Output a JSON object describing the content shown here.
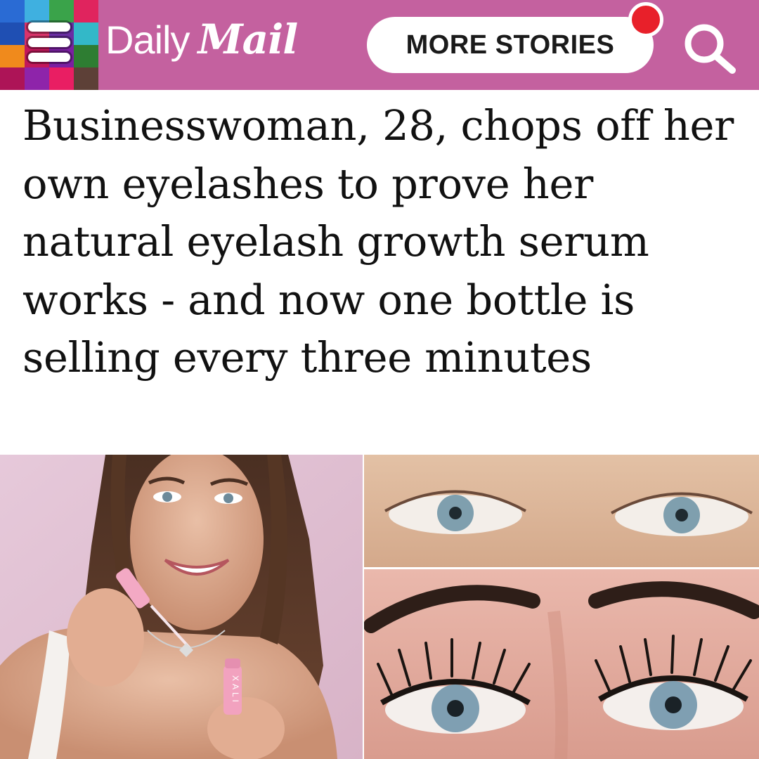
{
  "header": {
    "logo_daily": "Daily",
    "logo_mail": "Mail",
    "more_stories_label": "MORE STORIES",
    "icons": {
      "menu": "hamburger-menu-icon",
      "search": "search-icon",
      "notification": "notification-dot"
    },
    "colors": {
      "background": "#c4619f",
      "notification": "#e8202a",
      "menu_tiles": [
        "#2a6bd4",
        "#3fb0e0",
        "#3aa34a",
        "#e0245e",
        "#1f4fb3",
        "#d9336b",
        "#6a2ea3",
        "#33b8c8",
        "#f08a1c",
        "#c2185b",
        "#7b1fa2",
        "#2e7d32",
        "#ad1457",
        "#8e24aa",
        "#e91e63",
        "#5d4037"
      ]
    }
  },
  "article": {
    "headline": "Businesswoman, 28, chops off her own eyelashes to prove her natural eyelash growth serum works - and now one bottle is selling every three minutes"
  },
  "photos": {
    "left": {
      "description_label": "woman applying eyelash serum",
      "bottle_brand": "XALI"
    },
    "top_right": {
      "description_label": "eyes with short lashes"
    },
    "bottom_right": {
      "description_label": "eyes with long lashes"
    }
  }
}
